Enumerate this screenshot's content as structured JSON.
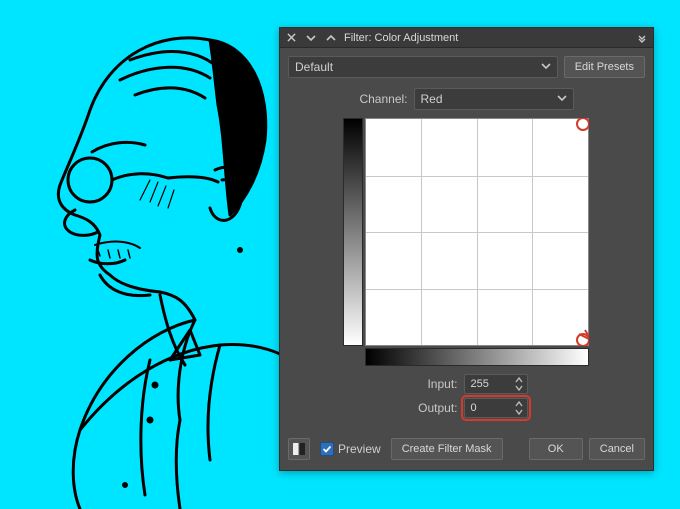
{
  "titlebar": {
    "title": "Filter: Color Adjustment"
  },
  "preset": {
    "selected": "Default",
    "edit_label": "Edit Presets"
  },
  "channel": {
    "label": "Channel:",
    "selected": "Red"
  },
  "curve": {
    "input_label": "Input:",
    "input_value": "255",
    "output_label": "Output:",
    "output_value": "0"
  },
  "footer": {
    "preview_label": "Preview",
    "preview_checked": true,
    "create_mask_label": "Create Filter Mask",
    "ok_label": "OK",
    "cancel_label": "Cancel"
  },
  "icons": {
    "close": "close-icon",
    "chevron_down": "chevron-down-icon",
    "chevron_up": "chevron-up-icon",
    "compare": "compare-icon"
  },
  "colors": {
    "canvas": "#00e5ff",
    "panel": "#4a4a4a",
    "accent_annotation": "#d43a2a"
  }
}
